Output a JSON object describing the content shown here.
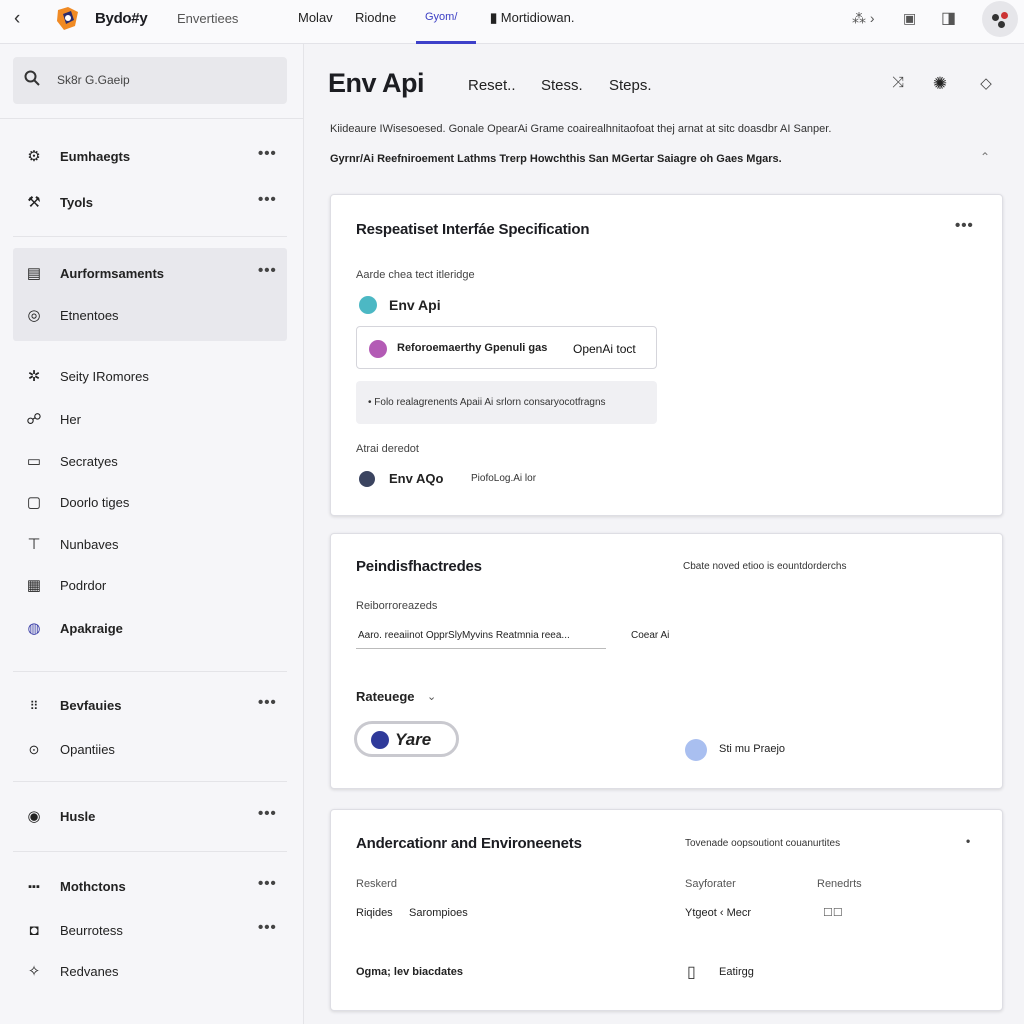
{
  "topbar": {
    "brand": "Bydo#y",
    "tab_label": "Envertiees",
    "nav": [
      "Molav",
      "Riodne",
      "Gyom/",
      "Mortidiowan."
    ],
    "active_nav_index": 2,
    "icons": [
      "back-arrow-icon",
      "app-logo",
      "code-icon",
      "calendar-icon",
      "window-icon",
      "avatar"
    ]
  },
  "sidebar": {
    "search_placeholder": "Sk8r G.Gaeip",
    "items": [
      {
        "label": "Eumhaegts",
        "icon": "gear-icon",
        "more": "•••"
      },
      {
        "label": "Tyols",
        "icon": "tools-icon",
        "more": "•••"
      },
      {
        "label": "Aurformsaments",
        "icon": "document-icon",
        "more": "•••"
      },
      {
        "label": "Etnentoes",
        "icon": "target-icon"
      },
      {
        "label": "Seity IRomores",
        "icon": "settings-icon"
      },
      {
        "label": "Her",
        "icon": "users-icon"
      },
      {
        "label": "Secratyes",
        "icon": "chat-icon"
      },
      {
        "label": "Doorlo tiges",
        "icon": "briefcase-icon"
      },
      {
        "label": "Nunbaves",
        "icon": "tag-icon"
      },
      {
        "label": "Podrdor",
        "icon": "grid-icon"
      },
      {
        "label": "Apakraige",
        "icon": "openai-icon"
      },
      {
        "label": "Bevfauies",
        "icon": "dots-grid-icon",
        "more": "•••"
      },
      {
        "label": "Opantiies",
        "icon": "circle-icon"
      },
      {
        "label": "Husle",
        "icon": "at-icon",
        "more": "•••"
      },
      {
        "label": "Mothctons",
        "icon": "bars-icon",
        "more": "•••"
      },
      {
        "label": "Beurrotess",
        "icon": "box-icon",
        "more": "•••"
      },
      {
        "label": "Redvanes",
        "icon": "star-icon"
      }
    ]
  },
  "header": {
    "title": "Env Api",
    "tabs": [
      "Reset..",
      "Stess.",
      "Steps."
    ],
    "desc1": "Kiideaure IWisesoesed. Gonale OpearAi Grame coairealhnitaofoat thej arnat at sitc doasdbr AI Sanper.",
    "desc2": "Gyrnr/Ai Reefniroement Lathms Trerp Howchthis San MGertar Saiagre oh Gaes Mgars."
  },
  "card1": {
    "title": "Respeatiset Interfáe Specification",
    "more": "•••",
    "label1": "Aarde chea tect itleridge",
    "env_name": "Env Api",
    "box_text": "Reforoemaerthy Gpenuli gas",
    "box_right": "OpenAi toct",
    "pill_text": "• Folo realagrenents Apaii Ai srlorn consaryocotfragns",
    "label2": "Atrai deredot",
    "env2": "Env AQo",
    "env2_side": "PiofoLog.Ai lor"
  },
  "card2": {
    "title": "Peindisfhactredes",
    "right_note": "Cbate noved etioo is eountdorderchs",
    "label": "Reiborroreazeds",
    "line_text": "Aaro. reeaiinot OpprSlyMyvins Reatmnia reea...",
    "line_right": "Coear Ai",
    "subhead": "Rateuege",
    "badge": "Yare",
    "right_label": "Sti mu Praejo"
  },
  "card3": {
    "title": "Andercationr and  Environeenets",
    "right_note": "Tovenade oopsoutiont couanurtites",
    "more": "•",
    "col1_head": "Reskerd",
    "col2_head": "Sayforater",
    "col3_head": "Renedrts",
    "row1_a": "Riqides",
    "row1_b": "Sarompioes",
    "row1_c": "Ytgeot  ‹ Mecr",
    "row1_d": "☐☐",
    "row2_a": "Ogma; lev biacdates",
    "row2_c": "Eatirgg"
  }
}
